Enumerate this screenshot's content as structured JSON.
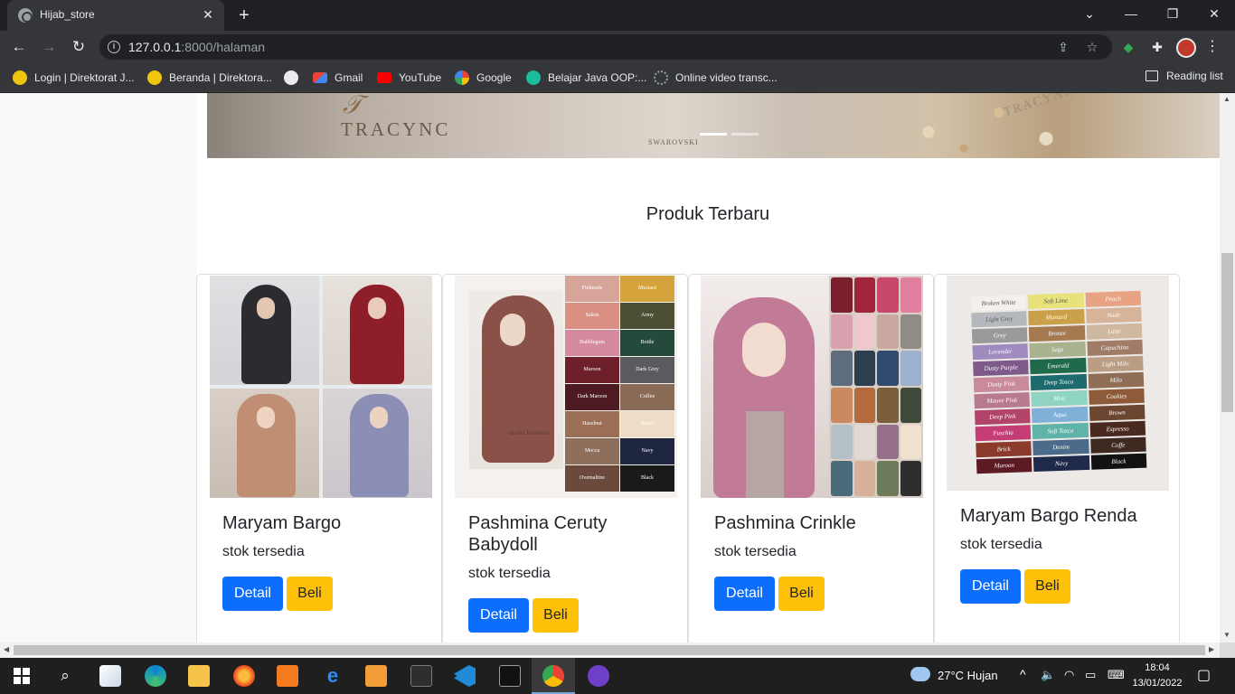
{
  "browser": {
    "tab_title": "Hijab_store",
    "url_host": "127.0.0.1",
    "url_rest": ":8000/halaman",
    "window_buttons": {
      "minimize": "—",
      "restore": "❐",
      "close": "✕"
    }
  },
  "bookmarks": [
    {
      "label": "Login | Direktorat J...",
      "icon": "direktorat-icon",
      "color": "#f1c40f"
    },
    {
      "label": "Beranda | Direktora...",
      "icon": "direktorat-icon",
      "color": "#f1c40f"
    },
    {
      "label": "",
      "icon": "globe-icon",
      "color": "#e8eaed"
    },
    {
      "label": "Gmail",
      "icon": "gmail-icon",
      "color": "#ea4335"
    },
    {
      "label": "YouTube",
      "icon": "youtube-icon",
      "color": "#ff0000"
    },
    {
      "label": "Google",
      "icon": "google-icon",
      "color": "#4285f4"
    },
    {
      "label": "Belajar Java OOP:...",
      "icon": "course-icon",
      "color": "#1abc9c"
    },
    {
      "label": "Online video transc...",
      "icon": "gear-icon",
      "color": "#9aa0a6"
    }
  ],
  "reading_list": "Reading list",
  "hero": {
    "brand": "TRACYNC",
    "brand_small": "TRACYNC",
    "tag": "SWAROVSKI"
  },
  "section_title": "Produk Terbaru",
  "products": [
    {
      "name": "Maryam Bargo",
      "stock": "stok tersedia",
      "detail": "Detail",
      "buy": "Beli"
    },
    {
      "name": "Pashmina Ceruty Babydoll",
      "stock": "stok tersedia",
      "detail": "Detail",
      "buy": "Beli"
    },
    {
      "name": "Pashmina Crinkle",
      "stock": "stok tersedia",
      "detail": "Detail",
      "buy": "Beli"
    },
    {
      "name": "Maryam Bargo Renda",
      "stock": "stok tersedia",
      "detail": "Detail",
      "buy": "Beli"
    }
  ],
  "swatches_ceruty": [
    "Pinknude",
    "Mustard",
    "Salem",
    "Army",
    "Bubblegum",
    "Bottle",
    "Maroon",
    "Dark Grey",
    "Dark Maroon",
    "Coffee",
    "Hazelnut",
    "Butter",
    "Mocca",
    "Navy",
    "Ovemaltine",
    "Black"
  ],
  "swatch_model_label": "model Hazelnut",
  "swatches_renda": [
    "Broken White",
    "Soft Lime",
    "Peach",
    "Light Grey",
    "Mustard",
    "Nude",
    "Grey",
    "Bronze",
    "Latte",
    "Lavender",
    "Sage",
    "Capuchino",
    "Dusty Purple",
    "Emerald",
    "Light Milo",
    "Dusty Pink",
    "Deep Tosca",
    "Milo",
    "Mauve Pink",
    "Mint",
    "Cookies",
    "Deep Pink",
    "Aqua",
    "Brown",
    "Fuschia",
    "Soft Tosca",
    "Espresso",
    "Brick",
    "Denim",
    "Coffe",
    "Maroon",
    "Navy",
    "Black"
  ],
  "taskbar": {
    "weather": "27°C  Hujan",
    "time": "18:04",
    "date": "13/01/2022"
  }
}
